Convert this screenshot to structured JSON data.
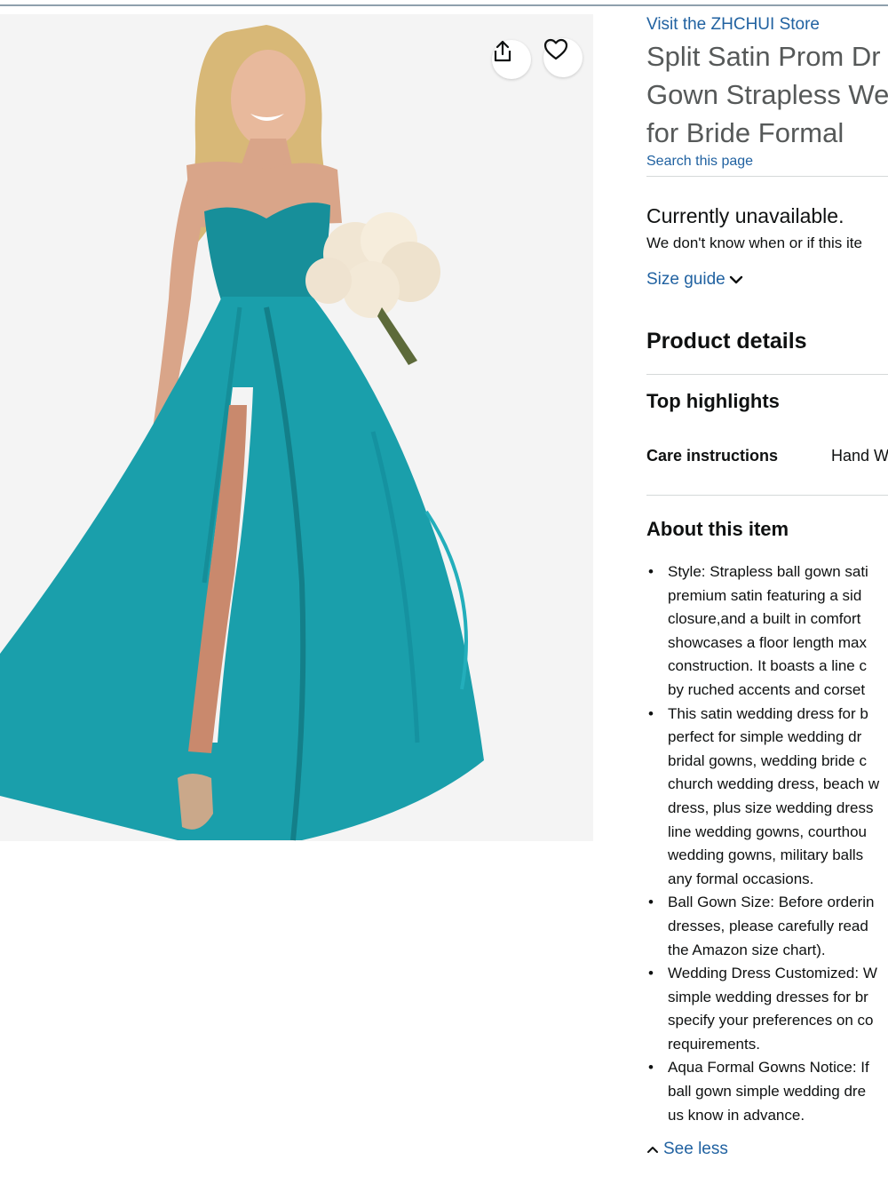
{
  "product": {
    "store_link": "Visit the ZHCHUI Store",
    "title_lines": [
      "Split Satin Prom Dr",
      "Gown Strapless We",
      "for Bride Formal"
    ],
    "search_link": "Search this page",
    "availability": "Currently unavailable.",
    "availability_note": "We don't know when or if this ite",
    "size_guide": "Size guide",
    "image_alt_colors": {
      "dress": "#1a9fab",
      "background": "#f4f4f4"
    }
  },
  "icons": {
    "share": "share-icon",
    "wishlist": "heart-icon",
    "chevron": "chevron-down-icon",
    "chevron_up": "chevron-up-icon"
  },
  "details": {
    "heading": "Product details",
    "top_highlights": "Top highlights",
    "rows": [
      {
        "label": "Care instructions",
        "value": "Hand W"
      }
    ]
  },
  "about": {
    "heading": "About this item",
    "bullets": [
      {
        "lines": [
          "Style: Strapless ball gown sati",
          "premium satin featuring a sid",
          "closure,and a built in comfort",
          "showcases a floor length max",
          "construction. It boasts a line c",
          "by ruched accents and corset"
        ]
      },
      {
        "lines": [
          "This satin wedding dress for b",
          "perfect for simple wedding dr",
          "bridal gowns, wedding bride c",
          "church wedding dress, beach w",
          "dress, plus size wedding dress",
          "line wedding gowns, courthou",
          "wedding gowns, military balls",
          "any formal occasions."
        ]
      },
      {
        "lines": [
          "Ball Gown Size: Before orderin",
          "dresses, please carefully read",
          "the Amazon size chart)."
        ]
      },
      {
        "lines": [
          "Wedding Dress Customized: W",
          "simple wedding dresses for br",
          "specify your preferences on co",
          "requirements."
        ]
      },
      {
        "lines": [
          "Aqua Formal Gowns Notice: If",
          "ball gown simple wedding dre",
          "us know in advance."
        ]
      }
    ],
    "see_less": "See less"
  }
}
